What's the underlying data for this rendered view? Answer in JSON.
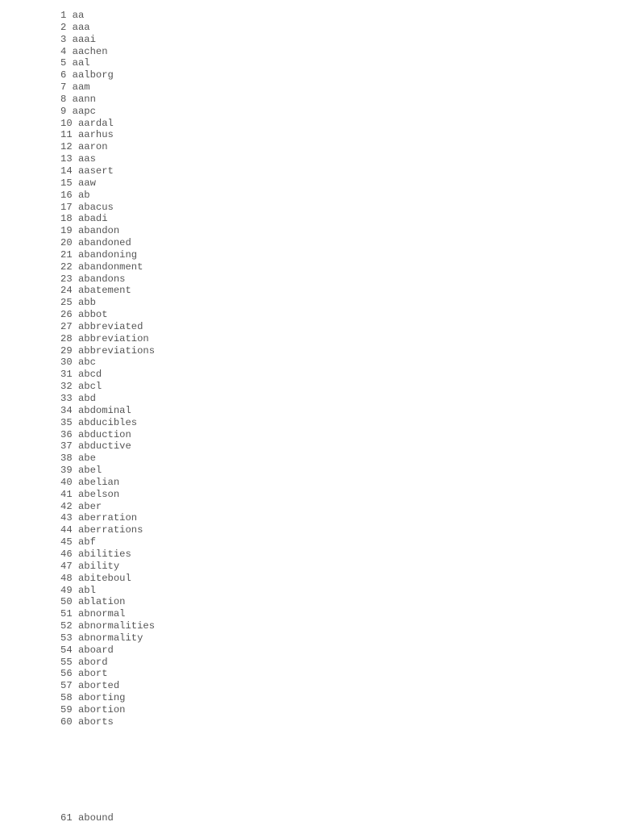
{
  "document": {
    "lines": [
      {
        "num": "1",
        "word": "aa"
      },
      {
        "num": "2",
        "word": "aaa"
      },
      {
        "num": "3",
        "word": "aaai"
      },
      {
        "num": "4",
        "word": "aachen"
      },
      {
        "num": "5",
        "word": "aal"
      },
      {
        "num": "6",
        "word": "aalborg"
      },
      {
        "num": "7",
        "word": "aam"
      },
      {
        "num": "8",
        "word": "aann"
      },
      {
        "num": "9",
        "word": "aapc"
      },
      {
        "num": "10",
        "word": "aardal"
      },
      {
        "num": "11",
        "word": "aarhus"
      },
      {
        "num": "12",
        "word": "aaron"
      },
      {
        "num": "13",
        "word": "aas"
      },
      {
        "num": "14",
        "word": "aasert"
      },
      {
        "num": "15",
        "word": "aaw"
      },
      {
        "num": "16",
        "word": "ab"
      },
      {
        "num": "17",
        "word": "abacus"
      },
      {
        "num": "18",
        "word": "abadi"
      },
      {
        "num": "19",
        "word": "abandon"
      },
      {
        "num": "20",
        "word": "abandoned"
      },
      {
        "num": "21",
        "word": "abandoning"
      },
      {
        "num": "22",
        "word": "abandonment"
      },
      {
        "num": "23",
        "word": "abandons"
      },
      {
        "num": "24",
        "word": "abatement"
      },
      {
        "num": "25",
        "word": "abb"
      },
      {
        "num": "26",
        "word": "abbot"
      },
      {
        "num": "27",
        "word": "abbreviated"
      },
      {
        "num": "28",
        "word": "abbreviation"
      },
      {
        "num": "29",
        "word": "abbreviations"
      },
      {
        "num": "30",
        "word": "abc"
      },
      {
        "num": "31",
        "word": "abcd"
      },
      {
        "num": "32",
        "word": "abcl"
      },
      {
        "num": "33",
        "word": "abd"
      },
      {
        "num": "34",
        "word": "abdominal"
      },
      {
        "num": "35",
        "word": "abducibles"
      },
      {
        "num": "36",
        "word": "abduction"
      },
      {
        "num": "37",
        "word": "abductive"
      },
      {
        "num": "38",
        "word": "abe"
      },
      {
        "num": "39",
        "word": "abel"
      },
      {
        "num": "40",
        "word": "abelian"
      },
      {
        "num": "41",
        "word": "abelson"
      },
      {
        "num": "42",
        "word": "aber"
      },
      {
        "num": "43",
        "word": "aberration"
      },
      {
        "num": "44",
        "word": "aberrations"
      },
      {
        "num": "45",
        "word": "abf"
      },
      {
        "num": "46",
        "word": "abilities"
      },
      {
        "num": "47",
        "word": "ability"
      },
      {
        "num": "48",
        "word": "abiteboul"
      },
      {
        "num": "49",
        "word": "abl"
      },
      {
        "num": "50",
        "word": "ablation"
      },
      {
        "num": "51",
        "word": "abnormal"
      },
      {
        "num": "52",
        "word": "abnormalities"
      },
      {
        "num": "53",
        "word": "abnormality"
      },
      {
        "num": "54",
        "word": "aboard"
      },
      {
        "num": "55",
        "word": "abord"
      },
      {
        "num": "56",
        "word": "abort"
      },
      {
        "num": "57",
        "word": "aborted"
      },
      {
        "num": "58",
        "word": "aborting"
      },
      {
        "num": "59",
        "word": "abortion"
      },
      {
        "num": "60",
        "word": "aborts"
      }
    ],
    "tail_lines": [
      {
        "num": "61",
        "word": "abound"
      }
    ]
  }
}
